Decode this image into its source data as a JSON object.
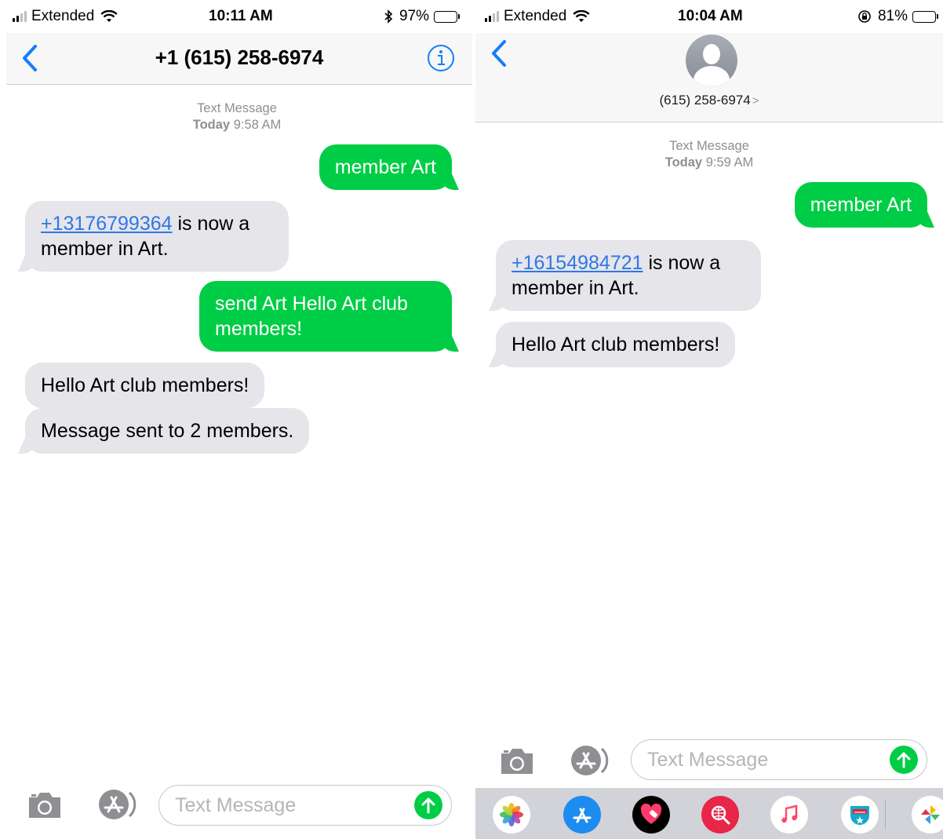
{
  "left": {
    "status": {
      "carrier": "Extended",
      "time": "10:11 AM",
      "battery_pct": "97%",
      "battery_level": 0.97
    },
    "nav": {
      "title": "+1 (615) 258-6974"
    },
    "thread_header": {
      "label": "Text Message",
      "day": "Today",
      "time": "9:58 AM"
    },
    "messages": [
      {
        "from": "me",
        "text": "member Art"
      },
      {
        "from": "them",
        "link": "+13176799364",
        "text": " is now a member in Art."
      },
      {
        "from": "me",
        "text": "send Art Hello Art club members!"
      },
      {
        "from": "them",
        "text": "Hello Art club members!"
      },
      {
        "from": "them",
        "text": "Message sent to 2 members."
      }
    ],
    "composer": {
      "placeholder": "Text Message"
    }
  },
  "right": {
    "status": {
      "carrier": "Extended",
      "time": "10:04 AM",
      "battery_pct": "81%",
      "battery_level": 0.81
    },
    "nav": {
      "contact": "(615) 258-6974",
      "chevron": ">"
    },
    "thread_header": {
      "label": "Text Message",
      "day": "Today",
      "time": "9:59 AM"
    },
    "messages": [
      {
        "from": "me",
        "text": "member Art"
      },
      {
        "from": "them",
        "link": "+16154984721",
        "text": " is now a member in Art."
      },
      {
        "from": "them",
        "text": "Hello Art club members!"
      }
    ],
    "composer": {
      "placeholder": "Text Message"
    },
    "drawer_apps": [
      "photos-icon",
      "app-store-icon",
      "digital-touch-icon",
      "web-search-icon",
      "music-icon",
      "espn-icon",
      "pinwheel-icon"
    ]
  },
  "colors": {
    "sent_bubble": "#00cd46",
    "received_bubble": "#e5e5ea",
    "link": "#2f77e8",
    "ios_blue": "#147efb"
  }
}
